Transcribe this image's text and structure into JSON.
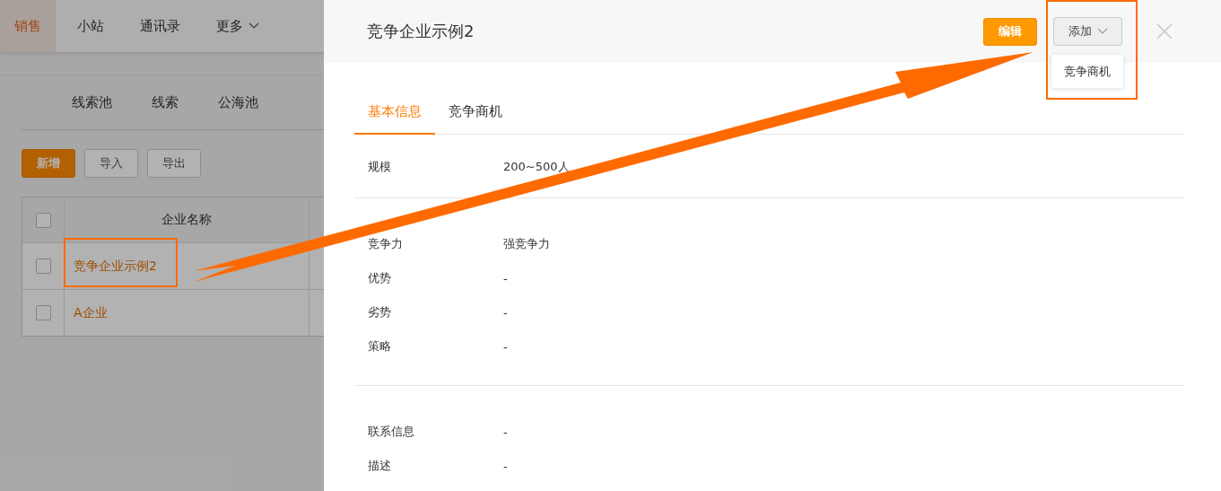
{
  "top_nav": [
    {
      "label": "销售",
      "selected": true,
      "kind": "link"
    },
    {
      "label": "小站",
      "selected": false,
      "kind": "link"
    },
    {
      "label": "通讯录",
      "selected": false,
      "kind": "link"
    },
    {
      "label": "更多",
      "selected": false,
      "kind": "menu"
    }
  ],
  "sub_tabs": [
    "线索池",
    "线索",
    "公海池"
  ],
  "toolbar": [
    {
      "label": "新增",
      "kind": "primary"
    },
    {
      "label": "导入",
      "kind": "default"
    },
    {
      "label": "导出",
      "kind": "default"
    }
  ],
  "table": {
    "select_all": {
      "checked": false
    },
    "columns": [
      "企业名称"
    ],
    "rows": [
      {
        "checked": false,
        "name": "竞争企业示例2"
      },
      {
        "checked": false,
        "name": "A企业"
      }
    ]
  },
  "drawer": {
    "title": "竞争企业示例2",
    "edit_button": "编辑",
    "add_button": {
      "label": "添加",
      "expanded": true
    },
    "add_menu": [
      "竞争商机"
    ],
    "tabs": [
      {
        "label": "基本信息",
        "selected": true
      },
      {
        "label": "竞争商机",
        "selected": false
      }
    ],
    "sections": [
      [
        {
          "label": "规模",
          "value": "200~500人"
        }
      ],
      [
        {
          "label": "竞争力",
          "value": "强竞争力"
        },
        {
          "label": "优势",
          "value": "-"
        },
        {
          "label": "劣势",
          "value": "-"
        },
        {
          "label": "策略",
          "value": "-"
        }
      ],
      [
        {
          "label": "联系信息",
          "value": "-"
        },
        {
          "label": "描述",
          "value": "-"
        }
      ]
    ]
  }
}
